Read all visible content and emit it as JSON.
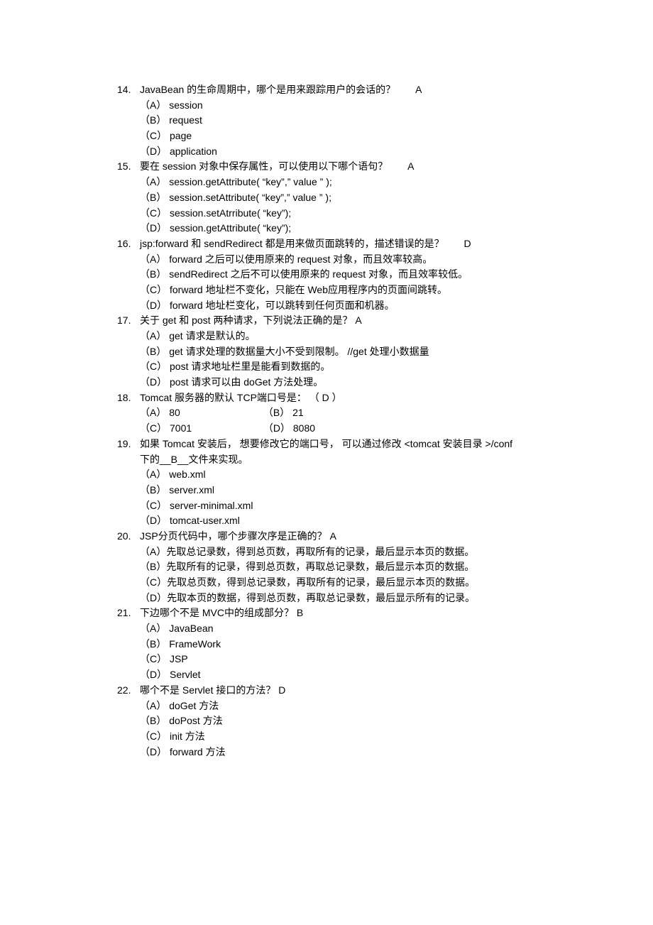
{
  "questions": [
    {
      "num": "14.",
      "text": "JavaBean 的生命周期中，哪个是用来跟踪用户的会话的？",
      "ans": "A",
      "opts": [
        "（A） session",
        "（B） request",
        "（C） page",
        "（D） application"
      ]
    },
    {
      "num": "15.",
      "text": "要在  session   对象中保存属性，可以使用以下哪个语句？",
      "ans": "A",
      "opts": [
        "（A） session.getAttribute(       “key”,” value ” );",
        "（B） session.setAttribute(       “key”,” value ” );",
        "（C） session.setAtrribute(       “key”);",
        "（D） session.getAttribute(       “key”);"
      ]
    },
    {
      "num": "16.",
      "text": "jsp:forward      和  sendRedirect    都是用来做页面跳转的，描述错误的是？",
      "ans": "D",
      "opts": [
        "（A） forward   之后可以使用原来的     request   对象，而且效率较高。",
        "（B） sendRedirect    之后不可以使用原来的      request   对象，而且效率较低。",
        "（C） forward   地址栏不变化，只能在     Web应用程序内的页面间跳转。",
        "（D） forward   地址栏变化，可以跳转到任何页面和机器。"
      ]
    },
    {
      "num": "17.",
      "text": "关于  get  和 post  两种请求，下列说法正确的是？      A",
      "ans": "",
      "opts": [
        "（A） get  请求是默认的。",
        "（B） get  请求处理的数据量大小不受到限制。      //get    处理小数据量",
        "（C） post  请求地址栏里是能看到数据的。",
        "（D） post  请求可以由   doGet 方法处理。"
      ]
    },
    {
      "num": "18.",
      "text": "Tomcat 服务器的默认   TCP端口号是：    （ D  ）",
      "ans": "",
      "inlineOpts": [
        [
          "（A） 80",
          "（B） 21"
        ],
        [
          "（C） 7001",
          "（D） 8080"
        ]
      ]
    },
    {
      "num": "19.",
      "text": "如果 Tomcat 安装后， 想要修改它的端口号，   可以通过修改   <tomcat  安装目录 >/conf",
      "text2": "下的__B__文件来实现。",
      "ans": "",
      "opts": [
        "（A） web.xml",
        "（B） server.xml",
        "（C） server-minimal.xml",
        "（D） tomcat-user.xml"
      ]
    },
    {
      "num": "20.",
      "text": "JSP分页代码中，哪个步骤次序是正确的？       A",
      "ans": "",
      "opts": [
        "（A）先取总记录数，得到总页数，再取所有的记录，最后显示本页的数据。",
        "（B）先取所有的记录，得到总页数，再取总记录数，最后显示本页的数据。",
        "（C）先取总页数，得到总记录数，再取所有的记录，最后显示本页的数据。",
        "（D）先取本页的数据，得到总页数，再取总记录数，最后显示所有的记录。"
      ]
    },
    {
      "num": "21.",
      "text": "下边哪个不是   MVC中的组成部分？    B",
      "ans": "",
      "opts": [
        "（A） JavaBean",
        "（B） FrameWork",
        "（C） JSP",
        "（D） Servlet"
      ]
    },
    {
      "num": "22.",
      "text": "哪个不是  Servlet   接口的方法？   D",
      "ans": "",
      "opts": [
        "（A） doGet 方法",
        "（B） doPost  方法",
        "（C） init    方法",
        "（D） forward   方法"
      ]
    }
  ]
}
